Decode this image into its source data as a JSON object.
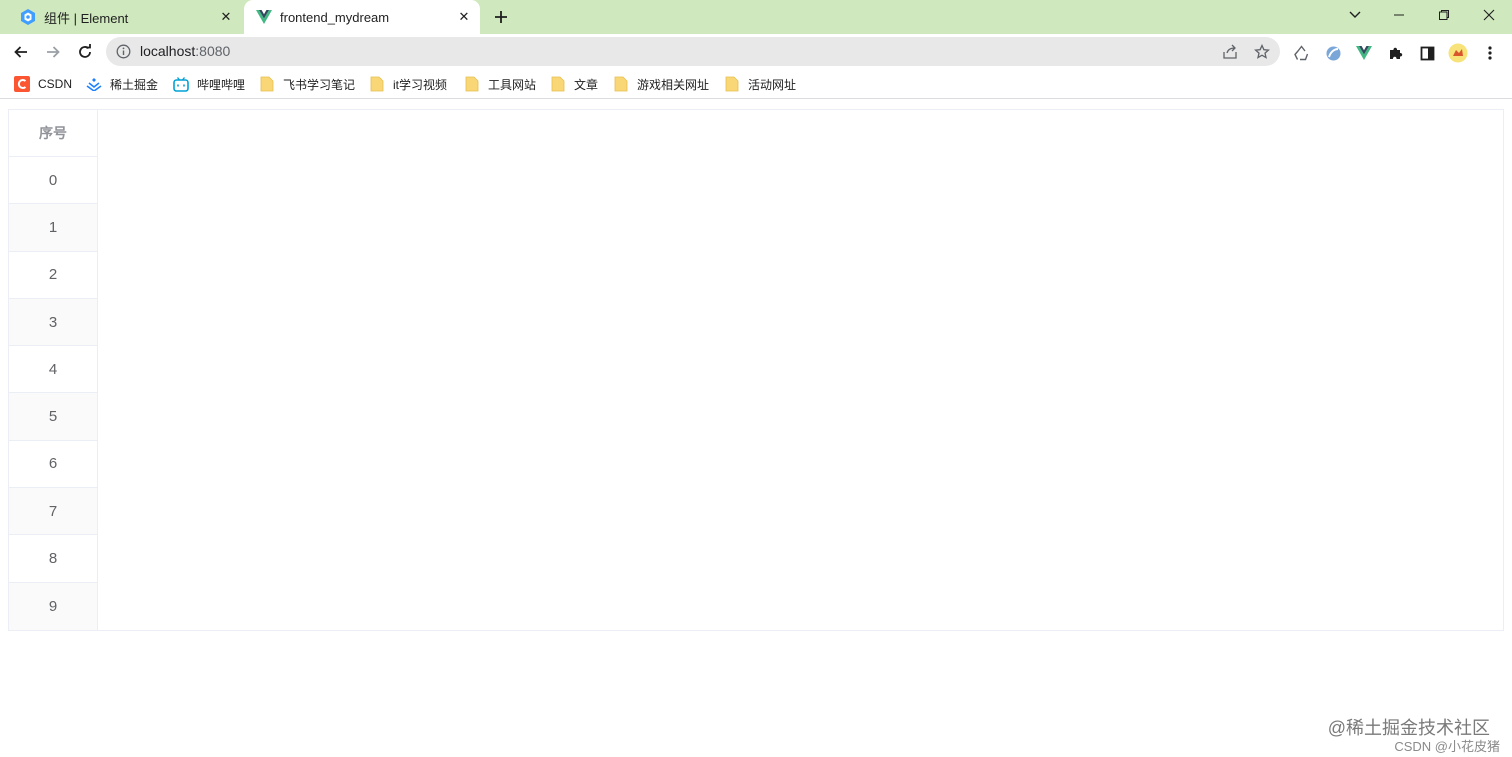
{
  "tabs": [
    {
      "title": "组件 | Element",
      "icon": "element-ui-icon",
      "active": false
    },
    {
      "title": "frontend_mydream",
      "icon": "vue-icon",
      "active": true
    }
  ],
  "toolbar": {
    "url_host": "localhost",
    "url_port": ":8080"
  },
  "bookmarks": [
    {
      "label": "CSDN",
      "icon": "csdn-icon"
    },
    {
      "label": "稀土掘金",
      "icon": "juejin-icon"
    },
    {
      "label": "哔哩哔哩",
      "icon": "bilibili-icon"
    },
    {
      "label": "飞书学习笔记",
      "icon": "folder-icon"
    },
    {
      "label": "it学习视频",
      "icon": "folder-icon"
    },
    {
      "label": "工具网站",
      "icon": "folder-icon"
    },
    {
      "label": "文章",
      "icon": "folder-icon"
    },
    {
      "label": "游戏相关网址",
      "icon": "folder-icon"
    },
    {
      "label": "活动网址",
      "icon": "folder-icon"
    }
  ],
  "table": {
    "header": "序号",
    "rows": [
      "0",
      "1",
      "2",
      "3",
      "4",
      "5",
      "6",
      "7",
      "8",
      "9"
    ]
  },
  "watermark": {
    "line1": "@稀土掘金技术社区",
    "line2": "CSDN @小花皮猪"
  },
  "colors": {
    "tabstrip": "#cfe8bd",
    "table_border": "#ebeef5",
    "header_text": "#909399",
    "cell_text": "#606266",
    "stripe": "#fafafa"
  }
}
